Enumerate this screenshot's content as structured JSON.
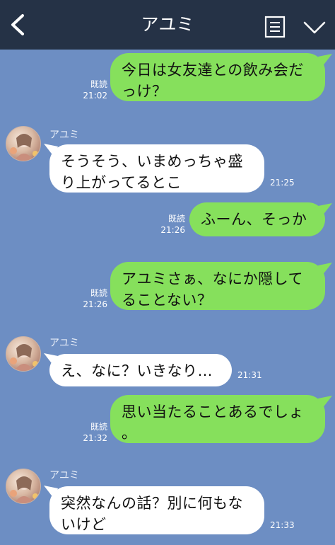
{
  "header": {
    "title": "アユミ",
    "back_icon": "chevron-left-icon",
    "menu_icon": "list-menu-icon",
    "dropdown_icon": "chevron-down-icon"
  },
  "colors": {
    "header_bg": "#253246",
    "chat_bg": "#6d8ec3",
    "outgoing_bubble": "#86e05c",
    "incoming_bubble": "#ffffff"
  },
  "messages": [
    {
      "side": "me",
      "text_lines": [
        "今日は女友達との飲み会だ",
        "っけ？"
      ],
      "read": "既読",
      "time": "21:02"
    },
    {
      "side": "them",
      "sender": "アユミ",
      "text_lines": [
        "そうそう、いまめっちゃ盛",
        "り上がってるとこ"
      ],
      "time": "21:25"
    },
    {
      "side": "me",
      "text_lines": [
        "ふーん、そっか"
      ],
      "read": "既読",
      "time": "21:26"
    },
    {
      "side": "me",
      "text_lines": [
        "アユミさぁ、なにか隠して",
        "ることない？"
      ],
      "read": "既読",
      "time": "21:26"
    },
    {
      "side": "them",
      "sender": "アユミ",
      "text_lines": [
        "え、なに？いきなり…"
      ],
      "time": "21:31"
    },
    {
      "side": "me",
      "text_lines": [
        "思い当たることあるでしょ",
        "。"
      ],
      "read": "既読",
      "time": "21:32"
    },
    {
      "side": "them",
      "sender": "アユミ",
      "text_lines": [
        "突然なんの話？別に何もな",
        "いけど"
      ],
      "time": "21:33"
    }
  ]
}
